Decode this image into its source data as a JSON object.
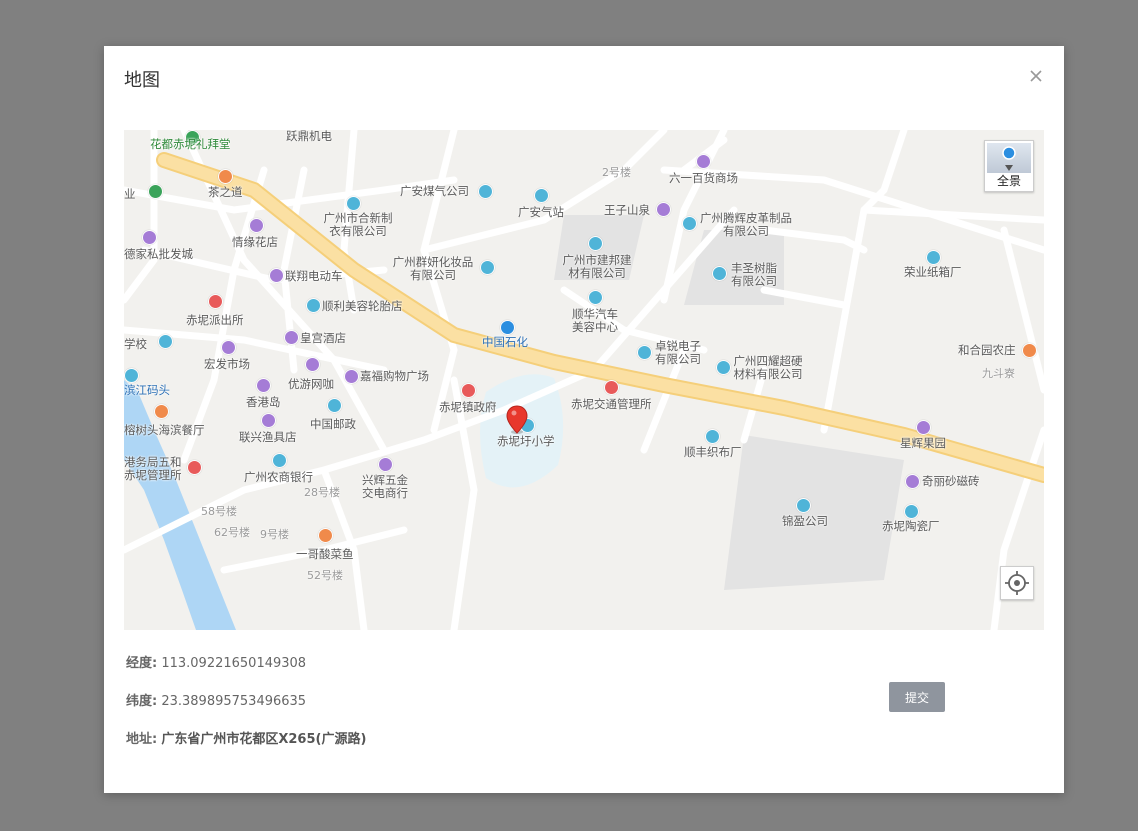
{
  "dialog": {
    "title": "地图",
    "submit_label": "提交"
  },
  "map": {
    "panorama_label": "全景",
    "labels": {
      "l1": "跃鼎机电",
      "l2": "花都赤坭礼拜堂",
      "l3": "茶之道",
      "l4": "业",
      "l5": "广州市合新制衣有限公司",
      "l6": "广安煤气公司",
      "l7": "广安气站",
      "l8": "2号楼",
      "l9": "六一百货商场",
      "l10": "王子山泉",
      "l11": "广州腾辉皮革制品有限公司",
      "l12": "德家私批发城",
      "l13": "情缘花店",
      "l14": "广州群妍化妆品有限公司",
      "l15": "广州市建邦建材有限公司",
      "l16": "丰圣树脂有限公司",
      "l17": "荣业纸箱厂",
      "l18": "联翔电动车",
      "l19": "赤坭派出所",
      "l20": "顺利美容轮胎店",
      "l21": "顺华汽车美容中心",
      "l22": "中国石化",
      "l23": "卓锐电子有限公司",
      "l24": "广州四耀超硬材料有限公司",
      "l25": "和合园农庄",
      "l26": "九斗寮",
      "l27": "学校",
      "l28": "皇宫酒店",
      "l29": "宏发市场",
      "l30": "优游网咖",
      "l31": "嘉福购物广场",
      "l32": "赤坭镇政府",
      "l33": "赤坭交通管理所",
      "l34": "滨江码头",
      "l35": "香港岛",
      "l36": "中国邮政",
      "l37": "赤坭圩小学",
      "l38": "顺丰织布厂",
      "l39": "星辉果园",
      "l40": "榕树头海滨餐厅",
      "l41": "联兴渔具店",
      "l42": "港务局五和赤坭管理所",
      "l43": "广州农商银行",
      "l44": "兴辉五金交电商行",
      "l45": "28号楼",
      "l46": "奇丽砂磁砖",
      "l47": "58号楼",
      "l48": "62号楼",
      "l49": "9号楼",
      "l50": "锦盈公司",
      "l51": "赤坭陶瓷厂",
      "l52": "一哥酸菜鱼",
      "l53": "52号楼"
    }
  },
  "info": {
    "lng_label": "经度:",
    "lng_value": "113.09221650149308",
    "lat_label": "纬度:",
    "lat_value": "23.389895753496635",
    "addr_label": "地址:",
    "addr_value": "广东省广州市花都区X265(广源路)"
  },
  "colors": {
    "main_road": "#fbe0a3",
    "minor_road": "#ffffff",
    "water": "#aed6f5",
    "pin": "#e8372c",
    "submit_bg": "#8f959e"
  }
}
